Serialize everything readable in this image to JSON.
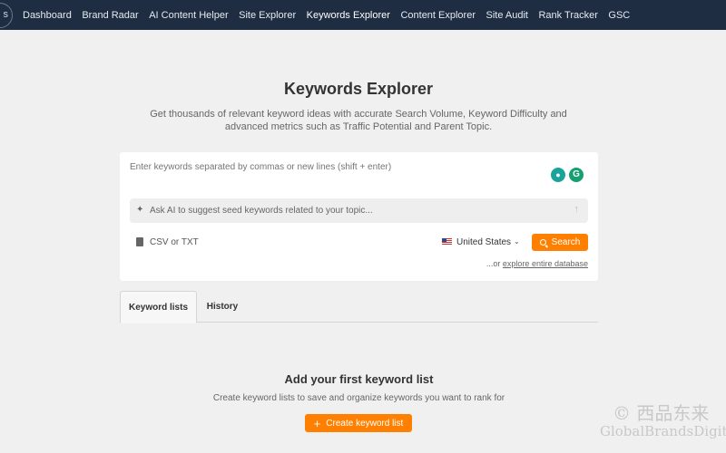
{
  "nav": {
    "logo_text": "s",
    "items": [
      "Dashboard",
      "Brand Radar",
      "AI Content Helper",
      "Site Explorer",
      "Keywords Explorer",
      "Content Explorer",
      "Site Audit",
      "Rank Tracker",
      "GSC"
    ],
    "active_index": 4
  },
  "header": {
    "title": "Keywords Explorer",
    "subtitle": "Get thousands of relevant keyword ideas with accurate Search Volume, Keyword Difficulty and advanced metrics such as Traffic Potential and Parent Topic."
  },
  "search": {
    "keywords_placeholder": "Enter keywords separated by commas or new lines (shift + enter)",
    "ai_placeholder": "Ask AI to suggest seed keywords related to your topic...",
    "upload_label": "CSV or TXT",
    "country": "United States",
    "search_button": "Search",
    "explore_prefix": "...or",
    "explore_link": "explore entire database",
    "ext_icon_b_letter": "G"
  },
  "tabs": [
    {
      "label": "Keyword lists",
      "active": true
    },
    {
      "label": "History",
      "active": false
    }
  ],
  "empty_state": {
    "title": "Add your first keyword list",
    "subtitle": "Create keyword lists to save and organize keywords you want to rank for",
    "button": "Create keyword list"
  },
  "watermark": {
    "line1": "© 西品东来",
    "line2": "GlobalBrandsDigital"
  },
  "colors": {
    "nav_bg": "#1f2d42",
    "accent": "#ff8000",
    "page_bg": "#f0f0f0"
  }
}
